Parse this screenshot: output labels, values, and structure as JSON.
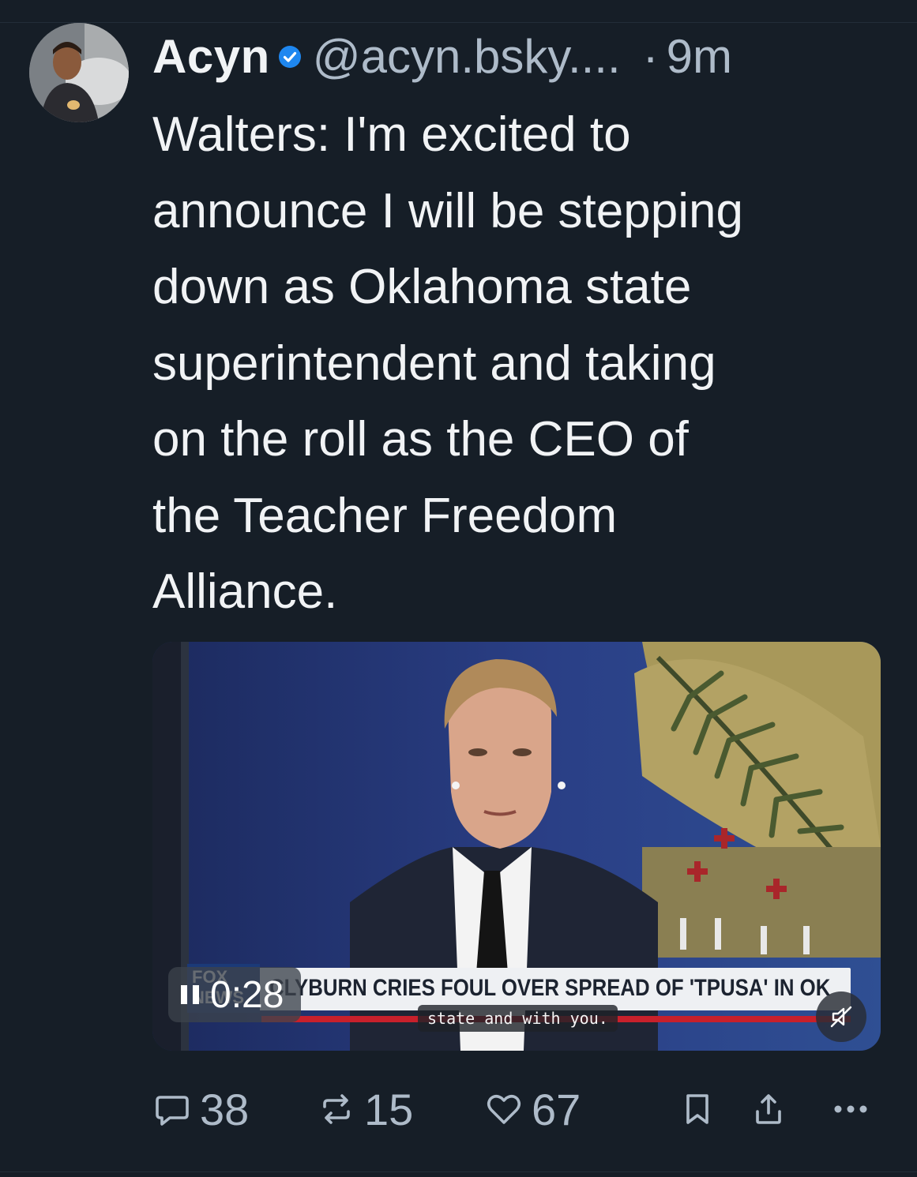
{
  "post": {
    "author_name": "Acyn",
    "handle": "@acyn.bsky....",
    "separator": "·",
    "time": "9m",
    "text": "Walters: I'm excited to\nannounce I will be stepping\ndown as Oklahoma state\nsuperintendent and taking\non the roll as the CEO of\nthe Teacher Freedom\nAlliance.",
    "verified": true
  },
  "video": {
    "timestamp": "0:28",
    "chyron_headline": "CLYBURN CRIES FOUL OVER SPREAD OF 'TPUSA' IN OK",
    "network_logo": "FOX NEWS",
    "caption": "state and with you.",
    "state": "playing",
    "muted": true
  },
  "actions": {
    "replies": "38",
    "reposts": "15",
    "likes": "67"
  },
  "colors": {
    "background": "#161e27",
    "secondary_text": "#aebbc9",
    "verified_badge": "#1e87f0"
  },
  "icons": [
    "verified-badge-icon",
    "pause-icon",
    "mute-icon",
    "reply-icon",
    "repost-icon",
    "like-icon",
    "bookmark-icon",
    "share-icon",
    "more-icon"
  ]
}
